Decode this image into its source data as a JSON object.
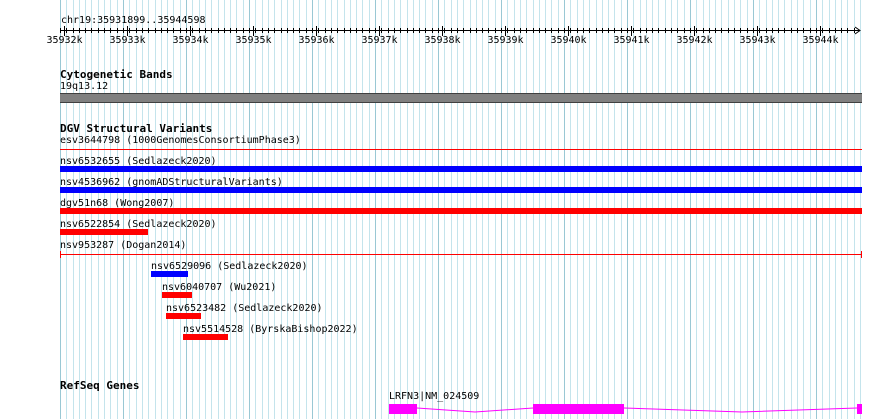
{
  "region": {
    "label": "chr19:35931899..35944598"
  },
  "ruler": {
    "ticks": [
      "35932k",
      "35933k",
      "35934k",
      "35935k",
      "35936k",
      "35937k",
      "35938k",
      "35939k",
      "35940k",
      "35941k",
      "35942k",
      "35943k",
      "35944k"
    ]
  },
  "tracks": {
    "cytoband": {
      "title": "Cytogenetic Bands",
      "band_label": "19q13.12",
      "color": "#808080"
    },
    "dgv": {
      "title": "DGV Structural Variants",
      "features": [
        {
          "label": "esv3644798 (1000GenomesConsortiumPhase3)",
          "color": "#ff0000",
          "style": "thin"
        },
        {
          "label": "nsv6532655 (Sedlazeck2020)",
          "color": "#0000ff",
          "style": "thick"
        },
        {
          "label": "nsv4536962 (gnomADStructuralVariants)",
          "color": "#0000ff",
          "style": "thick"
        },
        {
          "label": "dgv51n68 (Wong2007)",
          "color": "#ff0000",
          "style": "thick"
        },
        {
          "label": "nsv6522854 (Sedlazeck2020)",
          "color": "#ff0000",
          "style": "thick"
        },
        {
          "label": "nsv953287 (Dogan2014)",
          "color": "#ff0000",
          "style": "thin"
        },
        {
          "label": "nsv6529096 (Sedlazeck2020)",
          "color": "#0000ff",
          "style": "thick"
        },
        {
          "label": "nsv6040707 (Wu2021)",
          "color": "#ff0000",
          "style": "thick"
        },
        {
          "label": "nsv6523482 (Sedlazeck2020)",
          "color": "#ff0000",
          "style": "thick"
        },
        {
          "label": "nsv5514528 (ByrskaBishop2022)",
          "color": "#ff0000",
          "style": "thick"
        }
      ]
    },
    "refseq": {
      "title": "RefSeq Genes",
      "gene_label": "LRFN3|NM_024509",
      "color": "#ff00ff"
    }
  }
}
